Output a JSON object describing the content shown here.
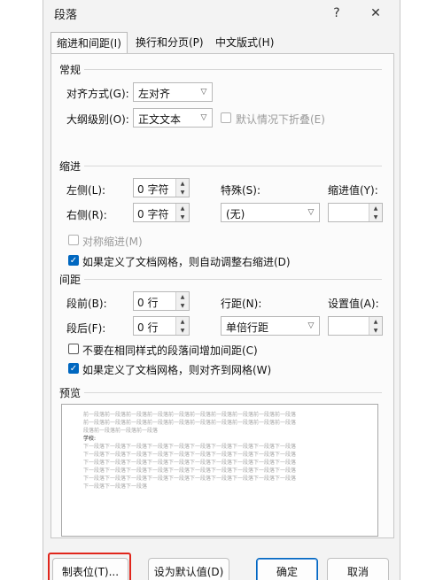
{
  "window": {
    "title": "段落",
    "help": "?",
    "close": "✕"
  },
  "tabs": [
    {
      "label": "缩进和间距(I)",
      "active": true
    },
    {
      "label": "换行和分页(P)",
      "active": false
    },
    {
      "label": "中文版式(H)",
      "active": false
    }
  ],
  "general": {
    "heading": "常规",
    "alignment_label": "对齐方式(G):",
    "alignment_value": "左对齐",
    "outline_label": "大纲级别(O):",
    "outline_value": "正文文本",
    "collapse_label": "默认情况下折叠(E)"
  },
  "indent": {
    "heading": "缩进",
    "left_label": "左侧(L):",
    "left_value": "0 字符",
    "right_label": "右侧(R):",
    "right_value": "0 字符",
    "special_label": "特殊(S):",
    "special_value": "(无)",
    "indent_by_label": "缩进值(Y):",
    "indent_by_value": "",
    "mirror_label": "对称缩进(M)",
    "auto_adjust_label": "如果定义了文档网格，则自动调整右缩进(D)"
  },
  "spacing": {
    "heading": "间距",
    "before_label": "段前(B):",
    "before_value": "0 行",
    "after_label": "段后(F):",
    "after_value": "0 行",
    "line_spacing_label": "行距(N):",
    "line_spacing_value": "单倍行距",
    "at_label": "设置值(A):",
    "at_value": "",
    "no_space_label": "不要在相同样式的段落间增加间距(C)",
    "snap_grid_label": "如果定义了文档网格，则对齐到网格(W)"
  },
  "preview": {
    "heading": "预览",
    "prev_lines": [
      "前一段落前一段落前一段落前一段落前一段落前一段落前一段落前一段落前一段落前一段落",
      "前一段落前一段落前一段落前一段落前一段落前一段落前一段落前一段落前一段落前一段落",
      "段落前一段落前一段落前一段落"
    ],
    "sample": "学校:",
    "next_lines": [
      "下一段落下一段落下一段落下一段落下一段落下一段落下一段落下一段落下一段落下一段落",
      "下一段落下一段落下一段落下一段落下一段落下一段落下一段落下一段落下一段落下一段落",
      "下一段落下一段落下一段落下一段落下一段落下一段落下一段落下一段落下一段落下一段落",
      "下一段落下一段落下一段落下一段落下一段落下一段落下一段落下一段落下一段落下一段落",
      "下一段落下一段落下一段落下一段落下一段落下一段落下一段落下一段落下一段落下一段落",
      "下一段落下一段落下一段落"
    ]
  },
  "buttons": {
    "tabs": "制表位(T)...",
    "set_default": "设为默认值(D)",
    "ok": "确定",
    "cancel": "取消"
  },
  "colors": {
    "accent": "#0067c0",
    "highlight": "#e0251b"
  }
}
